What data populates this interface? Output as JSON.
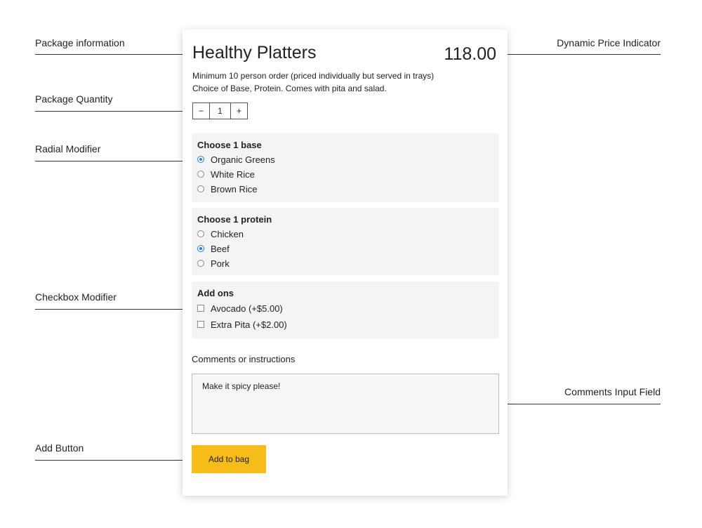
{
  "annotations": {
    "package_information": "Package information",
    "package_quantity": "Package Quantity",
    "radial_modifier": "Radial Modifier",
    "checkbox_modifier": "Checkbox Modifier",
    "add_button": "Add Button",
    "dynamic_price_indicator": "Dynamic Price Indicator",
    "comments_input_field": "Comments Input Field"
  },
  "product": {
    "title": "Healthy Platters",
    "price": "118.00",
    "description_line1": "Minimum 10 person order (priced individually but served in trays)",
    "description_line2": "Choice of Base, Protein. Comes with pita and salad."
  },
  "quantity": {
    "minus": "−",
    "value": "1",
    "plus": "+"
  },
  "groups": [
    {
      "title": "Choose 1 base",
      "type": "radio",
      "options": [
        {
          "label": "Organic Greens",
          "selected": true
        },
        {
          "label": "White Rice",
          "selected": false
        },
        {
          "label": "Brown Rice",
          "selected": false
        }
      ]
    },
    {
      "title": "Choose 1 protein",
      "type": "radio",
      "options": [
        {
          "label": "Chicken",
          "selected": false
        },
        {
          "label": "Beef",
          "selected": true
        },
        {
          "label": "Pork",
          "selected": false
        }
      ]
    },
    {
      "title": "Add ons",
      "type": "checkbox",
      "options": [
        {
          "label": "Avocado (+$5.00)",
          "selected": false
        },
        {
          "label": "Extra Pita (+$2.00)",
          "selected": false
        }
      ]
    }
  ],
  "comments": {
    "label": "Comments or instructions",
    "value": "Make it spicy please!"
  },
  "add_button": {
    "label": "Add to bag"
  },
  "colors": {
    "accent": "#f6bd1a",
    "radio_selected": "#2b7fd4",
    "group_background": "#f4f4f4"
  }
}
